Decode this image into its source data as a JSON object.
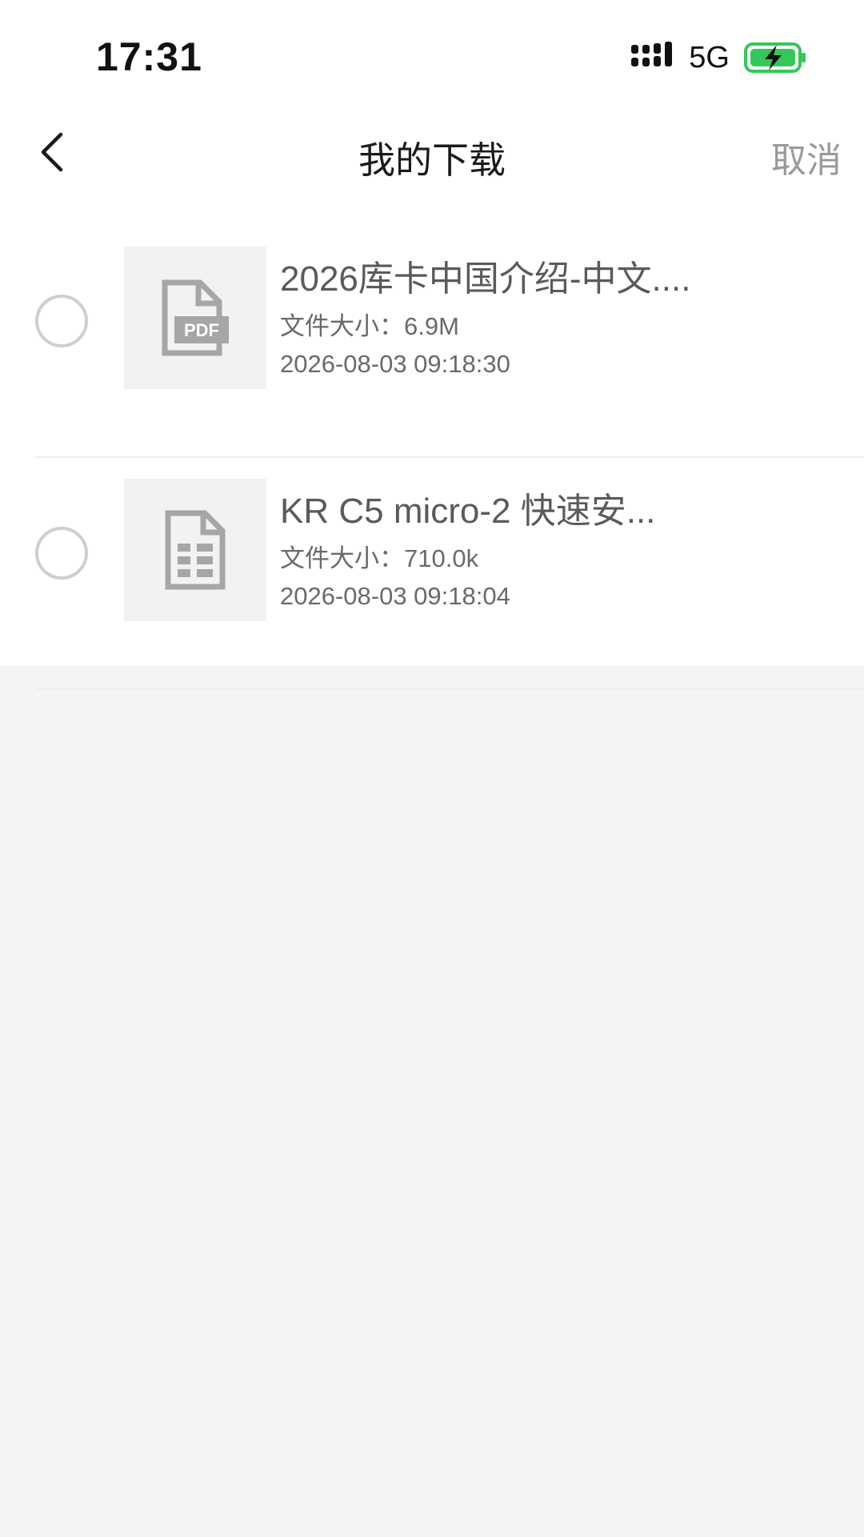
{
  "status_bar": {
    "time": "17:31",
    "network": "5G",
    "signal_icon": "signal-bars-icon",
    "battery_icon": "battery-charging-icon",
    "battery_color": "#34c759"
  },
  "nav": {
    "title": "我的下载",
    "cancel_label": "取消",
    "back_icon": "chevron-left-icon"
  },
  "downloads": [
    {
      "name": "2026库卡中国介绍-中文....",
      "size_text": "文件大小：6.9M",
      "date": "2026-08-03 09:18:30",
      "icon": "pdf-file-icon",
      "thumb_label": "PDF",
      "selected": false
    },
    {
      "name": "KR C5 micro-2 快速安...",
      "size_text": "文件大小：710.0k",
      "date": "2026-08-03 09:18:04",
      "icon": "document-file-icon",
      "selected": false
    }
  ],
  "colors": {
    "background": "#f4f4f4",
    "card": "#ffffff",
    "muted_text": "#9a9a9a",
    "icon_gray": "#a6a6a6"
  }
}
